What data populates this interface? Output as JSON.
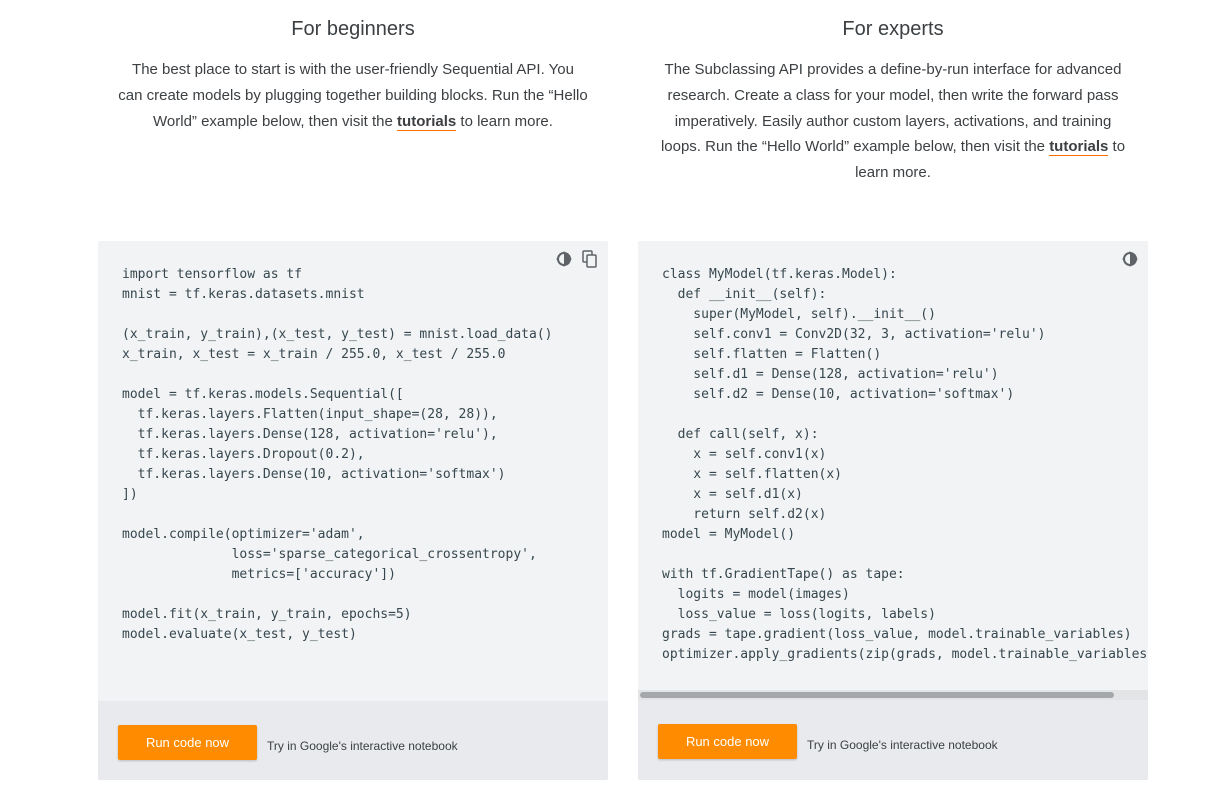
{
  "beginners": {
    "heading": "For beginners",
    "desc_before": "The best place to start is with the user-friendly Sequential API. You can create models by plugging together building blocks. Run the “Hello World” example below, then visit the ",
    "desc_link": "tutorials",
    "desc_after": " to learn more.",
    "code": "import tensorflow as tf\nmnist = tf.keras.datasets.mnist\n\n(x_train, y_train),(x_test, y_test) = mnist.load_data()\nx_train, x_test = x_train / 255.0, x_test / 255.0\n\nmodel = tf.keras.models.Sequential([\n  tf.keras.layers.Flatten(input_shape=(28, 28)),\n  tf.keras.layers.Dense(128, activation='relu'),\n  tf.keras.layers.Dropout(0.2),\n  tf.keras.layers.Dense(10, activation='softmax')\n])\n\nmodel.compile(optimizer='adam',\n              loss='sparse_categorical_crossentropy',\n              metrics=['accuracy'])\n\nmodel.fit(x_train, y_train, epochs=5)\nmodel.evaluate(x_test, y_test)",
    "run_button": "Run code now",
    "footer_note": "Try in Google's interactive notebook",
    "tools": [
      "theme-toggle-icon",
      "copy-icon"
    ]
  },
  "experts": {
    "heading": "For experts",
    "desc_before": "The Subclassing API provides a define-by-run interface for advanced research. Create a class for your model, then write the forward pass imperatively. Easily author custom layers, activations, and training loops. Run the “Hello World” example below, then visit the ",
    "desc_link": "tutorials",
    "desc_after": " to learn more.",
    "code": "class MyModel(tf.keras.Model):\n  def __init__(self):\n    super(MyModel, self).__init__()\n    self.conv1 = Conv2D(32, 3, activation='relu')\n    self.flatten = Flatten()\n    self.d1 = Dense(128, activation='relu')\n    self.d2 = Dense(10, activation='softmax')\n\n  def call(self, x):\n    x = self.conv1(x)\n    x = self.flatten(x)\n    x = self.d1(x)\n    return self.d2(x)\nmodel = MyModel()\n\nwith tf.GradientTape() as tape:\n  logits = model(images)\n  loss_value = loss(logits, labels)\ngrads = tape.gradient(loss_value, model.trainable_variables)\noptimizer.apply_gradients(zip(grads, model.trainable_variables))",
    "run_button": "Run code now",
    "footer_note": "Try in Google's interactive notebook",
    "tools": [
      "theme-toggle-icon"
    ]
  },
  "colors": {
    "accent": "#ff8c00",
    "link_underline": "#ff6f00",
    "code_bg": "#f1f3f4",
    "footer_bg": "#e8eaed"
  }
}
